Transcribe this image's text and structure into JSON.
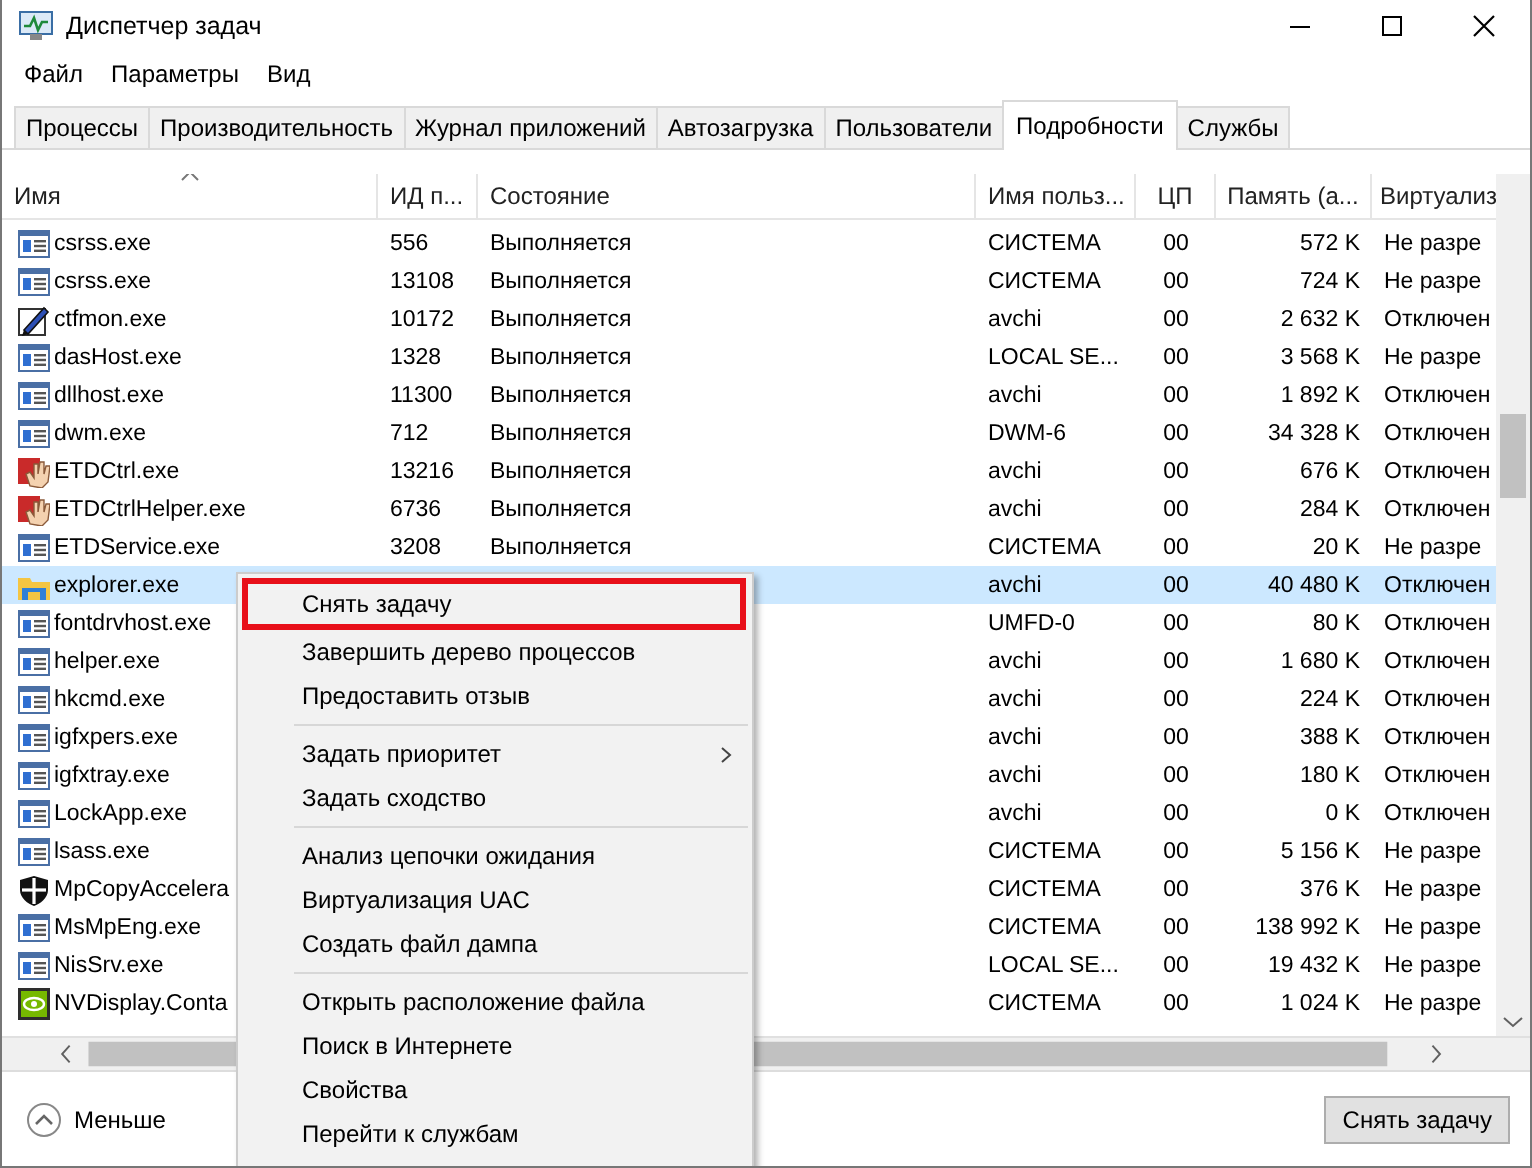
{
  "window": {
    "title": "Диспетчер задач"
  },
  "menu_bar": [
    "Файл",
    "Параметры",
    "Вид"
  ],
  "tabs": [
    {
      "label": "Процессы",
      "selected": false
    },
    {
      "label": "Производительность",
      "selected": false
    },
    {
      "label": "Журнал приложений",
      "selected": false
    },
    {
      "label": "Автозагрузка",
      "selected": false
    },
    {
      "label": "Пользователи",
      "selected": false
    },
    {
      "label": "Подробности",
      "selected": true
    },
    {
      "label": "Службы",
      "selected": false
    }
  ],
  "table": {
    "columns": [
      {
        "label": "Имя",
        "sorted": true
      },
      {
        "label": "ИД п...",
        "sorted": false
      },
      {
        "label": "Состояние",
        "sorted": false
      },
      {
        "label": "Имя польз...",
        "sorted": false
      },
      {
        "label": "ЦП",
        "sorted": false
      },
      {
        "label": "Память (а...",
        "sorted": false
      },
      {
        "label": "Виртуализ",
        "sorted": false
      }
    ],
    "rows": [
      {
        "kind": "app",
        "selected": false,
        "cells": [
          "csrss.exe",
          "556",
          "Выполняется",
          "СИСТЕМА",
          "00",
          "572 K",
          "Не разре"
        ]
      },
      {
        "kind": "app",
        "selected": false,
        "cells": [
          "csrss.exe",
          "13108",
          "Выполняется",
          "СИСТЕМА",
          "00",
          "724 K",
          "Не разре"
        ]
      },
      {
        "kind": "pen",
        "selected": false,
        "cells": [
          "ctfmon.exe",
          "10172",
          "Выполняется",
          "avchi",
          "00",
          "2 632 K",
          "Отключен"
        ]
      },
      {
        "kind": "app",
        "selected": false,
        "cells": [
          "dasHost.exe",
          "1328",
          "Выполняется",
          "LOCAL SE...",
          "00",
          "3 568 K",
          "Не разре"
        ]
      },
      {
        "kind": "app",
        "selected": false,
        "cells": [
          "dllhost.exe",
          "11300",
          "Выполняется",
          "avchi",
          "00",
          "1 892 K",
          "Отключен"
        ]
      },
      {
        "kind": "app",
        "selected": false,
        "cells": [
          "dwm.exe",
          "712",
          "Выполняется",
          "DWM-6",
          "00",
          "34 328 K",
          "Отключен"
        ]
      },
      {
        "kind": "hand",
        "selected": false,
        "cells": [
          "ETDCtrl.exe",
          "13216",
          "Выполняется",
          "avchi",
          "00",
          "676 K",
          "Отключен"
        ]
      },
      {
        "kind": "hand",
        "selected": false,
        "cells": [
          "ETDCtrlHelper.exe",
          "6736",
          "Выполняется",
          "avchi",
          "00",
          "284 K",
          "Отключен"
        ]
      },
      {
        "kind": "app",
        "selected": false,
        "cells": [
          "ETDService.exe",
          "3208",
          "Выполняется",
          "СИСТЕМА",
          "00",
          "20 K",
          "Не разре"
        ]
      },
      {
        "kind": "folder",
        "selected": true,
        "cells": [
          "explorer.exe",
          null,
          null,
          "avchi",
          "00",
          "40 480 K",
          "Отключен"
        ]
      },
      {
        "kind": "app",
        "selected": false,
        "cells": [
          "fontdrvhost.exe",
          null,
          null,
          "UMFD-0",
          "00",
          "80 K",
          "Отключен"
        ]
      },
      {
        "kind": "app",
        "selected": false,
        "cells": [
          "helper.exe",
          null,
          null,
          "avchi",
          "00",
          "1 680 K",
          "Отключен"
        ]
      },
      {
        "kind": "app",
        "selected": false,
        "cells": [
          "hkcmd.exe",
          null,
          null,
          "avchi",
          "00",
          "224 K",
          "Отключен"
        ]
      },
      {
        "kind": "app",
        "selected": false,
        "cells": [
          "igfxpers.exe",
          null,
          null,
          "avchi",
          "00",
          "388 K",
          "Отключен"
        ]
      },
      {
        "kind": "app",
        "selected": false,
        "cells": [
          "igfxtray.exe",
          null,
          null,
          "avchi",
          "00",
          "180 K",
          "Отключен"
        ]
      },
      {
        "kind": "app",
        "selected": false,
        "cells": [
          "LockApp.exe",
          null,
          null,
          "avchi",
          "00",
          "0 K",
          "Отключен"
        ]
      },
      {
        "kind": "app",
        "selected": false,
        "cells": [
          "lsass.exe",
          null,
          null,
          "СИСТЕМА",
          "00",
          "5 156 K",
          "Не разре"
        ]
      },
      {
        "kind": "shield",
        "selected": false,
        "cells": [
          "MpCopyAccelera",
          null,
          null,
          "СИСТЕМА",
          "00",
          "376 K",
          "Не разре"
        ]
      },
      {
        "kind": "app",
        "selected": false,
        "cells": [
          "MsMpEng.exe",
          null,
          null,
          "СИСТЕМА",
          "00",
          "138 992 K",
          "Не разре"
        ]
      },
      {
        "kind": "app",
        "selected": false,
        "cells": [
          "NisSrv.exe",
          null,
          null,
          "LOCAL SE...",
          "00",
          "19 432 K",
          "Не разре"
        ]
      },
      {
        "kind": "nvidia",
        "selected": false,
        "cells": [
          "NVDisplay.Conta",
          null,
          null,
          "СИСТЕМА",
          "00",
          "1 024 K",
          "Не разре"
        ]
      }
    ]
  },
  "context_menu": {
    "items": [
      {
        "kind": "item",
        "label": "Снять задачу",
        "highlighted": true
      },
      {
        "kind": "item",
        "label": "Завершить дерево процессов",
        "highlighted": false
      },
      {
        "kind": "item",
        "label": "Предоставить отзыв",
        "highlighted": false
      },
      {
        "kind": "separator"
      },
      {
        "kind": "submenu",
        "label": "Задать приоритет",
        "highlighted": false
      },
      {
        "kind": "item",
        "label": "Задать сходство",
        "highlighted": false
      },
      {
        "kind": "separator"
      },
      {
        "kind": "item",
        "label": "Анализ цепочки ожидания",
        "highlighted": false
      },
      {
        "kind": "item",
        "label": "Виртуализация UAC",
        "highlighted": false
      },
      {
        "kind": "item",
        "label": "Создать файл дампа",
        "highlighted": false
      },
      {
        "kind": "separator"
      },
      {
        "kind": "item",
        "label": "Открыть расположение файла",
        "highlighted": false
      },
      {
        "kind": "item",
        "label": "Поиск в Интернете",
        "highlighted": false
      },
      {
        "kind": "item",
        "label": "Свойства",
        "highlighted": false
      },
      {
        "kind": "item",
        "label": "Перейти к службам",
        "highlighted": false
      }
    ]
  },
  "footer": {
    "toggle": "Меньше",
    "button": "Снять задачу"
  }
}
